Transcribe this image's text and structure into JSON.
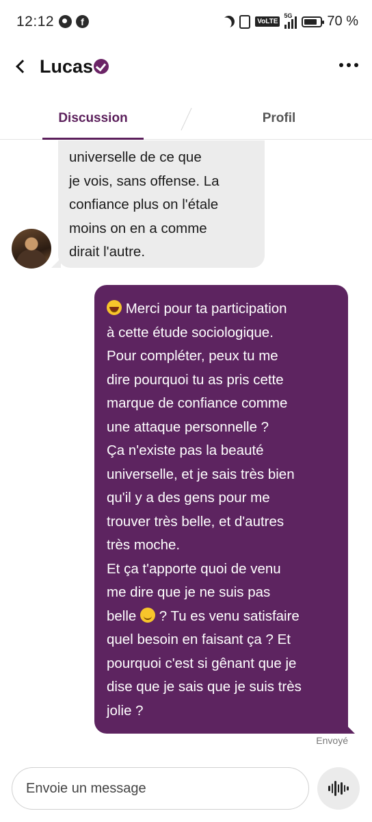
{
  "status_bar": {
    "time": "12:12",
    "battery_text": "70 %",
    "network_label": "5G",
    "volte_label": "VoLTE",
    "battery_level": 0.7
  },
  "header": {
    "contact_name": "Lucas",
    "verified": true
  },
  "tabs": [
    {
      "label": "Discussion",
      "active": true
    },
    {
      "label": "Profil",
      "active": false
    }
  ],
  "messages": {
    "incoming": {
      "text": "universelle de ce que\nje vois, sans offense. La\nconfiance plus on l'étale\nmoins on en a comme\ndirait l'autre."
    },
    "outgoing": {
      "line1_after_emoji": " Merci pour ta participation",
      "part2": "à cette étude sociologique.\nPour compléter, peux tu me\ndire pourquoi tu as pris cette\nmarque de confiance comme\nune attaque personnelle ?\nÇa n'existe pas la beauté\nuniverselle, et je sais très bien\nqu'il y a des gens pour me\ntrouver très belle, et d'autres\ntrès moche.\nEt ça t'apporte quoi de venu\nme dire que je ne suis pas\nbelle ",
      "part3": " ? Tu es venu satisfaire\nquel besoin en faisant ça ? Et\npourquoi c'est si gênant que je\ndise que je sais que je suis très\njolie ?",
      "status": "Envoyé"
    }
  },
  "composer": {
    "placeholder": "Envoie un message"
  },
  "colors": {
    "accent": "#5d2460",
    "incoming_bubble": "#ececec",
    "outgoing_text": "#ffffff"
  },
  "icons": {
    "back": "chevron-left-icon",
    "verified": "verified-badge-icon",
    "more": "more-horizontal-icon",
    "voice": "microphone-wave-icon"
  }
}
